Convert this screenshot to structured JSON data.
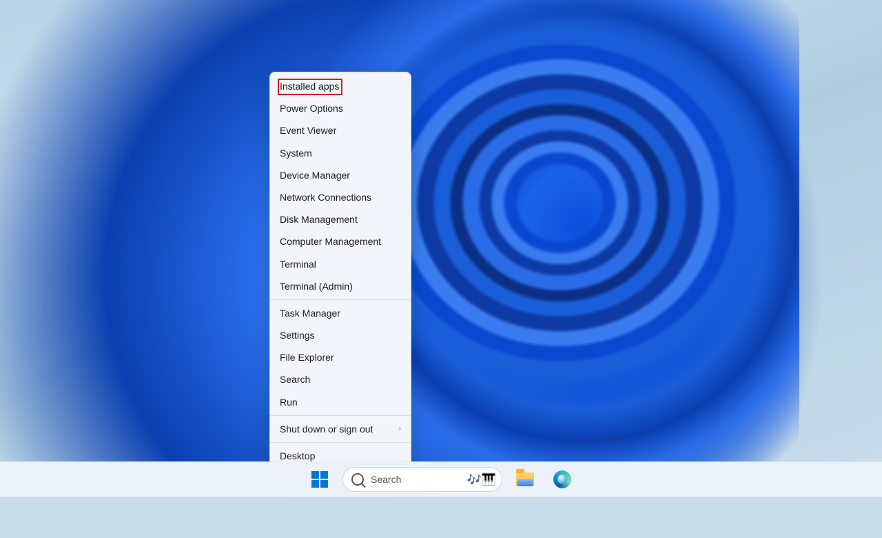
{
  "context_menu": {
    "highlighted_index": 0,
    "groups": [
      {
        "items": [
          {
            "label": "Installed apps",
            "submenu": false
          },
          {
            "label": "Power Options",
            "submenu": false
          },
          {
            "label": "Event Viewer",
            "submenu": false
          },
          {
            "label": "System",
            "submenu": false
          },
          {
            "label": "Device Manager",
            "submenu": false
          },
          {
            "label": "Network Connections",
            "submenu": false
          },
          {
            "label": "Disk Management",
            "submenu": false
          },
          {
            "label": "Computer Management",
            "submenu": false
          },
          {
            "label": "Terminal",
            "submenu": false
          },
          {
            "label": "Terminal (Admin)",
            "submenu": false
          }
        ]
      },
      {
        "items": [
          {
            "label": "Task Manager",
            "submenu": false
          },
          {
            "label": "Settings",
            "submenu": false
          },
          {
            "label": "File Explorer",
            "submenu": false
          },
          {
            "label": "Search",
            "submenu": false
          },
          {
            "label": "Run",
            "submenu": false
          }
        ]
      },
      {
        "items": [
          {
            "label": "Shut down or sign out",
            "submenu": true
          }
        ]
      },
      {
        "items": [
          {
            "label": "Desktop",
            "submenu": false
          }
        ]
      }
    ]
  },
  "taskbar": {
    "search_placeholder": "Search",
    "spotlight_emoji": "🎶🎹"
  }
}
